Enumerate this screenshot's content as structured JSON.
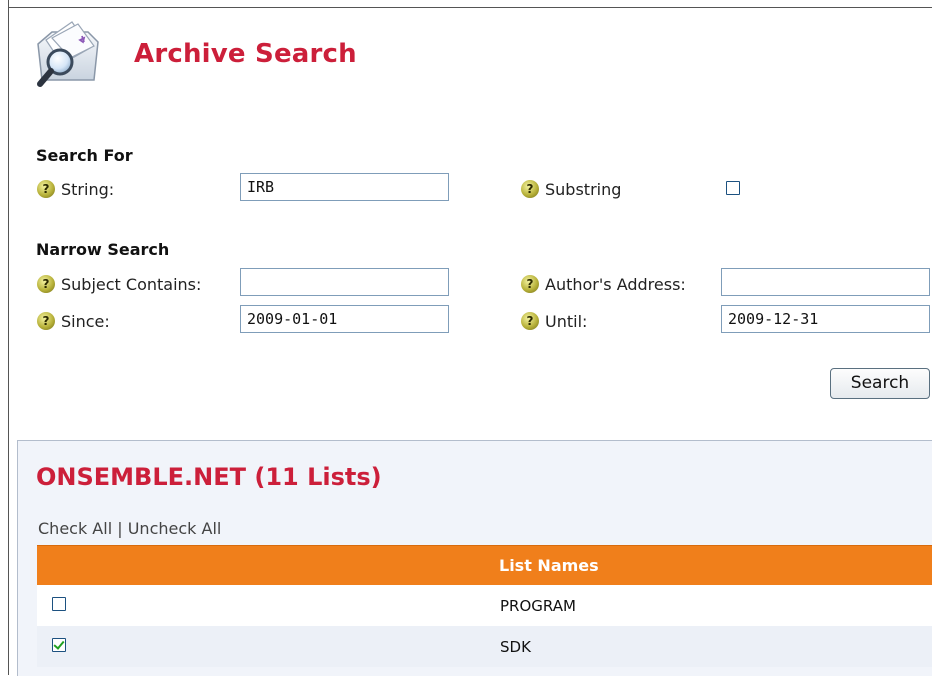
{
  "header": {
    "title": "Archive Search",
    "logo_icon": "archive-search-icon"
  },
  "search_for": {
    "heading": "Search For",
    "string_label": "String:",
    "string_value": "IRB",
    "substring_label": "Substring",
    "substring_checked": false
  },
  "narrow_search": {
    "heading": "Narrow Search",
    "subject_label": "Subject Contains:",
    "subject_value": "",
    "author_label": "Author's Address:",
    "author_value": "",
    "since_label": "Since:",
    "since_value": "2009-01-01",
    "until_label": "Until:",
    "until_value": "2009-12-31"
  },
  "actions": {
    "search_label": "Search"
  },
  "results": {
    "group_title": "ONSEMBLE.NET (11 Lists)",
    "check_all": "Check All",
    "separator": "|",
    "uncheck_all": "Uncheck All",
    "column_header": "List Names",
    "rows": [
      {
        "name": "PROGRAM",
        "checked": false
      },
      {
        "name": "SDK",
        "checked": true
      }
    ]
  },
  "colors": {
    "title_red": "#cc1f3a",
    "header_orange": "#f07f1b",
    "panel_bg": "#f1f4fa",
    "check_green": "#21a121"
  }
}
